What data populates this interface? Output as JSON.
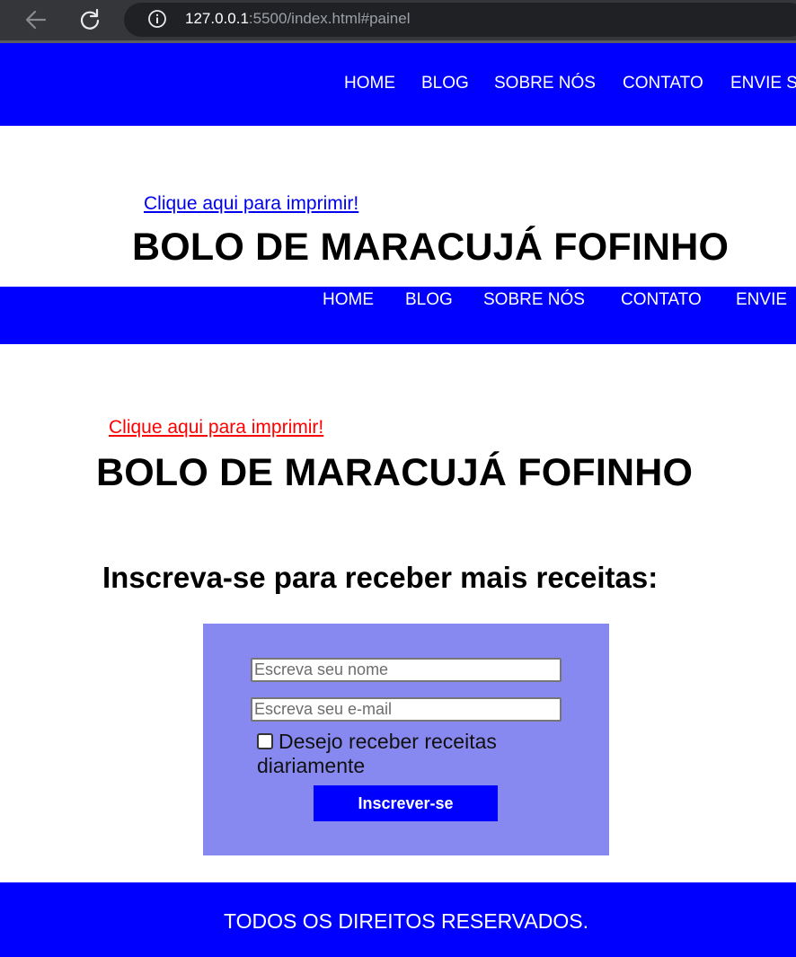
{
  "browser": {
    "url_host": "127.0.0.1",
    "url_rest": ":5500/index.html#painel"
  },
  "navbar_1": {
    "items": [
      "HOME",
      "BLOG",
      "SOBRE NÓS",
      "CONTATO",
      "ENVIE S"
    ]
  },
  "section_1": {
    "print_link": "Clique aqui para imprimir!",
    "title": "BOLO DE MARACUJÁ FOFINHO"
  },
  "navbar_2": {
    "items": [
      "HOME",
      "BLOG",
      "SOBRE NÓS",
      "CONTATO",
      "ENVIE"
    ]
  },
  "section_2": {
    "print_link": "Clique aqui para imprimir!",
    "title": "BOLO DE MARACUJÁ FOFINHO"
  },
  "subscribe": {
    "heading": "Inscreva-se para receber mais receitas:",
    "name_placeholder": "Escreva seu nome",
    "email_placeholder": "Escreva seu e-mail",
    "checkbox_label": "Desejo receber receitas diariamente",
    "button_label": "Inscrever-se"
  },
  "footer": {
    "text": "TODOS OS DIREITOS RESERVADOS."
  },
  "colors": {
    "nav_bg": "#0000ff",
    "form_bg": "#8888f1",
    "print_link_1": "#0000ee",
    "print_link_2": "#ff0000"
  },
  "icons": {
    "back": "back-arrow-icon",
    "reload": "reload-icon",
    "info": "info-icon"
  }
}
